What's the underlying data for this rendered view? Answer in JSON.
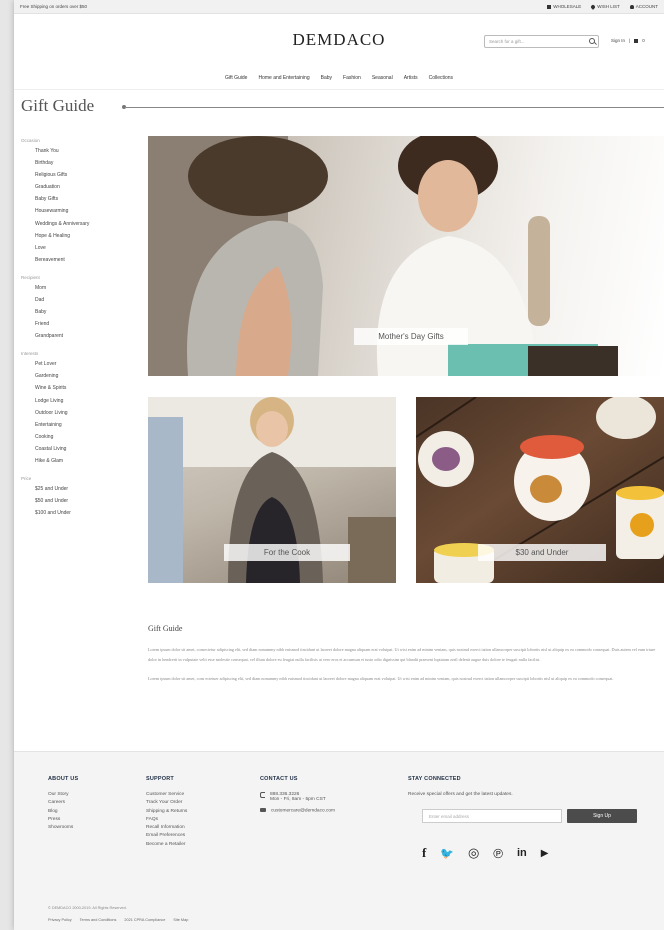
{
  "topbar": {
    "promo": "Free Shipping on orders over $50",
    "links": [
      "WHOLESALE",
      "WISH LIST",
      "ACCOUNT"
    ]
  },
  "header": {
    "logo": "DEMDACO",
    "search_placeholder": "Search for a gift...",
    "sign_in": "Sign In",
    "cart": "0"
  },
  "nav": [
    "Gift Guide",
    "Home and Entertaining",
    "Baby",
    "Fashion",
    "Seasonal",
    "Artists",
    "Collections"
  ],
  "page_title": "Gift Guide",
  "sidebar": {
    "groups": [
      {
        "heading": "Occasion",
        "items": [
          "Thank You",
          "Birthday",
          "Religious Gifts",
          "Graduation",
          "Baby Gifts",
          "Housewarming",
          "Weddings & Anniversary",
          "Hope & Healing",
          "Love",
          "Bereavement"
        ]
      },
      {
        "heading": "Recipient",
        "items": [
          "Mom",
          "Dad",
          "Baby",
          "Friend",
          "Grandparent"
        ]
      },
      {
        "heading": "Interests",
        "items": [
          "Pet Lover",
          "Gardening",
          "Wine & Spirits",
          "Lodge Living",
          "Outdoor Living",
          "Entertaining",
          "Cooking",
          "Coastal Living",
          "Hike & Glam"
        ]
      },
      {
        "heading": "Price",
        "items": [
          "$25 and Under",
          "$50 and Under",
          "$100 and Under"
        ]
      }
    ]
  },
  "tiles": {
    "hero": "Mother's Day Gifts",
    "cook": "For the Cook",
    "mugs": "$30 and Under"
  },
  "article": {
    "title": "Gift Guide",
    "para1": "Lorem ipsum dolor sit amet, consectetur adipiscing elit, sed diam nonummy nibh euismod tincidunt ut laoreet dolore magna aliquam erat volutpat. Ut wisi enim ad minim veniam, quis nostrud exerci tation ullamcorper suscipit lobortis nisl ut aliquip ex ea commodo consequat. Duis autem vel eum iriure dolor in hendrerit in vulputate velit esse molestie consequat, vel illum dolore eu feugiat nulla facilisis at vero eros et accumsan et iusto odio dignissim qui blandit praesent luptatum zzril delenit augue duis dolore te feugait nulla facilisi.",
    "para2": "Lorem ipsum dolor sit amet, cons ectetuer adipiscing elit, sed diam nonummy nibh euismod tincidunt ut laoreet dolore magna aliquam erat volutpat. Ut wisi enim ad minim veniam, quis nostrud exerci tation ullamcorper suscipit lobortis nisl ut aliquip ex ea commodo consequat."
  },
  "footer": {
    "about": {
      "heading": "ABOUT US",
      "items": [
        "Our Story",
        "Careers",
        "Blog",
        "Press",
        "Showrooms"
      ]
    },
    "support": {
      "heading": "SUPPORT",
      "items": [
        "Customer Service",
        "Track Your Order",
        "Shipping & Returns",
        "FAQs",
        "Recall Information",
        "Email Preferences",
        "Become a Retailer"
      ]
    },
    "contact": {
      "heading": "CONTACT US",
      "phone": "888.336.3226",
      "hours": "Mon - Fri, 8am - 5pm CST",
      "email": "customercare@demdaco.com"
    },
    "stay": {
      "heading": "STAY CONNECTED",
      "blurb": "Receive special offers and get the latest updates.",
      "email_placeholder": "Enter email address",
      "button": "Sign Up"
    },
    "social": [
      "f",
      "🐦",
      "◎",
      "℗",
      "in",
      "▶"
    ],
    "copyright": "© DEMDACO 2000-2019. All Rights Reserved.",
    "legal_links": [
      "Privacy Policy",
      "Terms and Conditions",
      "2021 CPRA Compliance",
      "Site Map"
    ]
  }
}
